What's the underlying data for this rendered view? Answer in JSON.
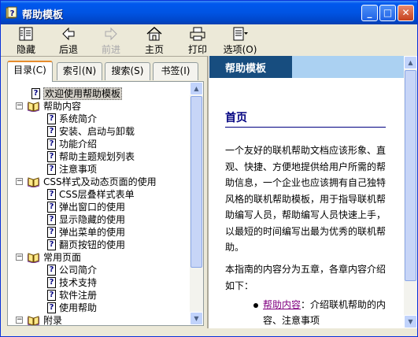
{
  "window": {
    "title": "帮助模板",
    "buttons": {
      "minimize": "_",
      "maximize": "□",
      "close": "✕"
    }
  },
  "toolbar": {
    "items": [
      {
        "label": "隐藏",
        "icon": "hide-icon",
        "enabled": true
      },
      {
        "label": "后退",
        "icon": "back-arrow-icon",
        "enabled": true
      },
      {
        "label": "前进",
        "icon": "forward-arrow-icon",
        "enabled": false
      },
      {
        "label": "主页",
        "icon": "home-icon",
        "enabled": true
      },
      {
        "label": "打印",
        "icon": "print-icon",
        "enabled": true
      },
      {
        "label": "选项(O)",
        "icon": "options-icon",
        "enabled": true
      }
    ]
  },
  "nav": {
    "tabs": [
      {
        "label": "目录(C)",
        "active": true
      },
      {
        "label": "索引(N)",
        "active": false
      },
      {
        "label": "搜索(S)",
        "active": false
      },
      {
        "label": "书签(I)",
        "active": false
      }
    ],
    "tree": [
      {
        "label": "欢迎使用帮助模板",
        "type": "page",
        "level": 1,
        "selected": true
      },
      {
        "label": "帮助内容",
        "type": "book",
        "level": 0,
        "expanded": true
      },
      {
        "label": "系统简介",
        "type": "page",
        "level": 2
      },
      {
        "label": "安装、启动与卸载",
        "type": "page",
        "level": 2
      },
      {
        "label": "功能介绍",
        "type": "page",
        "level": 2
      },
      {
        "label": "帮助主题规划列表",
        "type": "page",
        "level": 2
      },
      {
        "label": "注意事项",
        "type": "page",
        "level": 2
      },
      {
        "label": "CSS样式及动态页面的使用",
        "type": "book",
        "level": 0,
        "expanded": true
      },
      {
        "label": "CSS层叠样式表单",
        "type": "page",
        "level": 2
      },
      {
        "label": "弹出窗口的使用",
        "type": "page",
        "level": 2
      },
      {
        "label": "显示隐藏的使用",
        "type": "page",
        "level": 2
      },
      {
        "label": "弹出菜单的使用",
        "type": "page",
        "level": 2
      },
      {
        "label": "翻页按钮的使用",
        "type": "page",
        "level": 2
      },
      {
        "label": "常用页面",
        "type": "book",
        "level": 0,
        "expanded": true
      },
      {
        "label": "公司简介",
        "type": "page",
        "level": 2
      },
      {
        "label": "技术支持",
        "type": "page",
        "level": 2
      },
      {
        "label": "软件注册",
        "type": "page",
        "level": 2
      },
      {
        "label": "使用帮助",
        "type": "page",
        "level": 2
      },
      {
        "label": "附录",
        "type": "book",
        "level": 0,
        "expanded": true
      }
    ]
  },
  "content": {
    "header": "帮助模板",
    "heading": "首页",
    "paragraph1": "一个友好的联机帮助文档应该形象、直观、快捷、方便地提供给用户所需的帮助信息，一个企业也应该拥有自己独特风格的联机帮助模板，用于指导联机帮助编写人员，帮助编写人员快速上手，以最短的时间编写出最为优秀的联机帮助。",
    "paragraph2": "本指南的内容分为五章，各章内容介绍如下：",
    "bullet_link": "帮助内容",
    "bullet_text": "：介绍联机帮助的内容、注意事项"
  }
}
